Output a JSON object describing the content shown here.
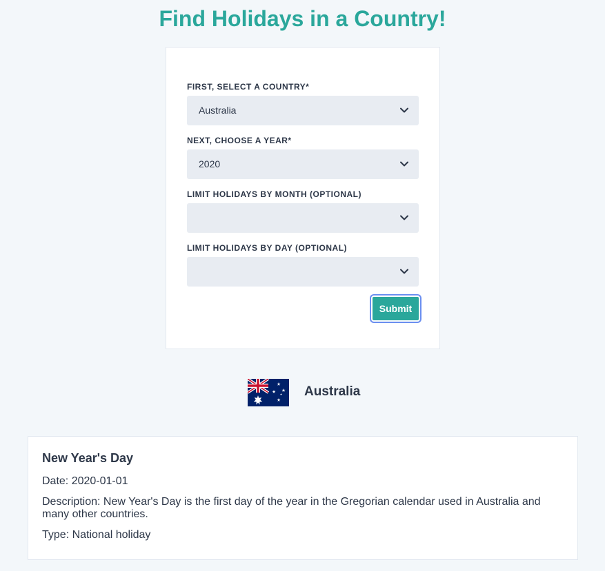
{
  "header": {
    "title": "Find Holidays in a Country!"
  },
  "form": {
    "country": {
      "label": "FIRST, SELECT A COUNTRY*",
      "value": "Australia",
      "icon": "chevron-down-icon"
    },
    "year": {
      "label": "NEXT, CHOOSE A YEAR*",
      "value": "2020",
      "icon": "chevron-down-icon"
    },
    "month": {
      "label": "LIMIT HOLIDAYS BY MONTH (OPTIONAL)",
      "value": "",
      "icon": "chevron-down-icon"
    },
    "day": {
      "label": "LIMIT HOLIDAYS BY DAY (OPTIONAL)",
      "value": "",
      "icon": "chevron-down-icon"
    },
    "submit_label": "Submit"
  },
  "result": {
    "flag_icon": "australia-flag-icon",
    "country_name": "Australia",
    "holidays": [
      {
        "name": "New Year's Day",
        "date": "Date: 2020-01-01",
        "description": "Description: New Year's Day is the first day of the year in the Gregorian calendar used in Australia and many other countries.",
        "type": "Type: National holiday"
      }
    ]
  },
  "colors": {
    "accent": "#2aa79b",
    "background": "#f3f7fa",
    "select_background": "#e8ecf2",
    "focus_ring": "#6b8ff0",
    "text": "#2d3748"
  }
}
